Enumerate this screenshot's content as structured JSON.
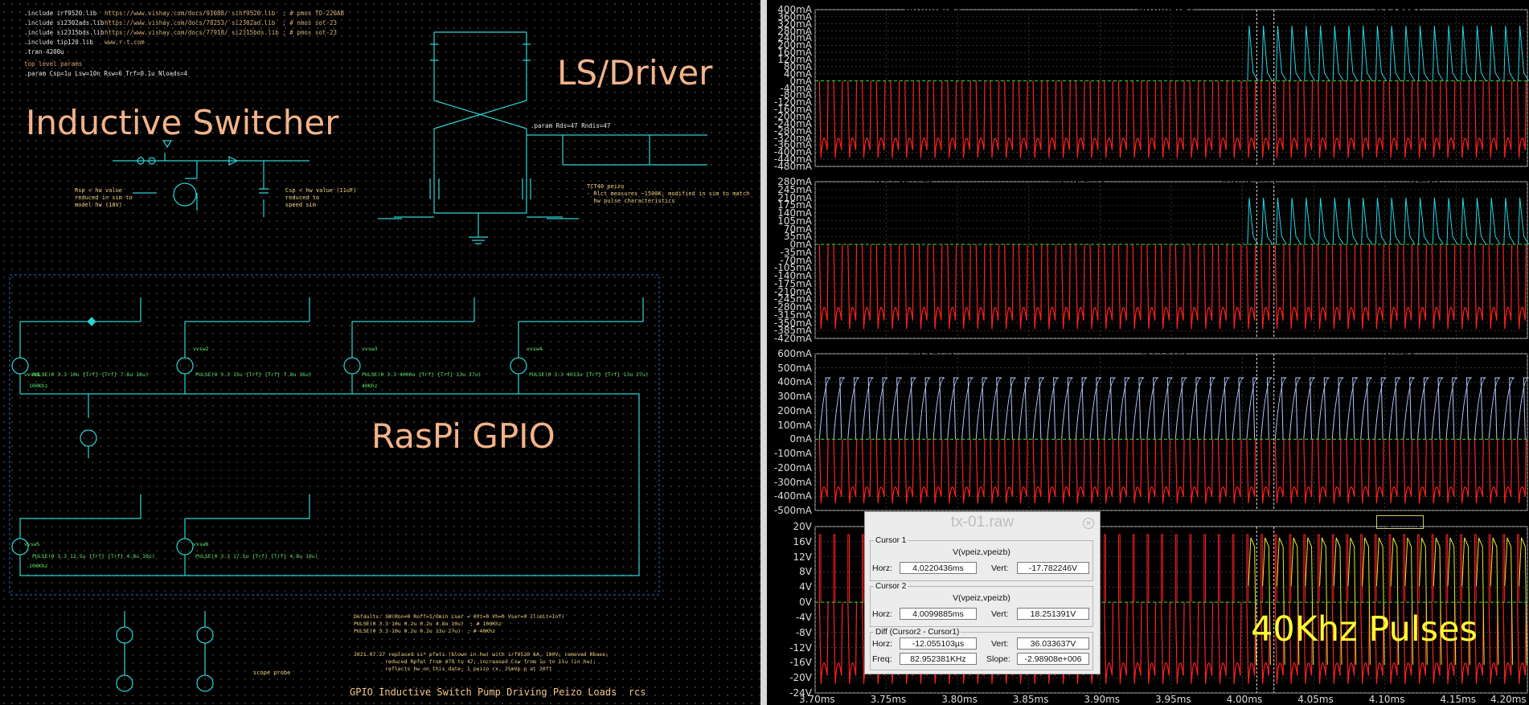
{
  "schematic": {
    "directives": [
      ".include irf9520.lib",
      ".include si2302ads.lib",
      ".include si2315bds.lib",
      ".include tip120.lib"
    ],
    "urls": [
      "https://www.vishay.com/docs/91088/ sihf9520.lib  ; # pmos TO-220AB",
      "https://www.vishay.com/docs/78253/ si2302ad.lib  ; # nmos sot-23",
      "https://www.vishay.com/docs/77918/ si2315bds.lib ; # pmos sot-23",
      "www.r-t.com"
    ],
    "tran": ".tran 4200u",
    "params_label": "top level params",
    "params": ".param Csp=1u Lsw=10n Rsw=6 Trf=0.1u Nloads=4",
    "title_inductive": "Inductive Switcher",
    "title_ls": "LS/Driver",
    "title_raspi": "RasPi GPIO",
    "note_rsp": "Rsp < hw value\nreduced in sim to\nmodel hw (18V)",
    "note_csp": "Csp < hw value (11uF)\nreduced to\nspeed sim",
    "param_rds": ".param Rds=47 Rndis=47",
    "note_tct": "TCT40 peizo\n- Rlct measures ~1500K; modified in sim to match\n  hw pulse characteristics",
    "sources": [
      {
        "name": "vvsw1",
        "pulse": "PULSE(0 3.3 10u {Trf} {Trf} 7.8u 16u)",
        "freq": "100Khz"
      },
      {
        "name": "vvsw2",
        "pulse": "PULSE(0 3.3 15u {Trf} {Trf} 7.8u 16u)",
        "freq": ""
      },
      {
        "name": "vvsw3",
        "pulse": "PULSE(0 3.3 4000u {Trf} {Trf} 13u 27u)",
        "freq": "40Khz"
      },
      {
        "name": "vvsw4",
        "pulse": "PULSE(0 3.3 4013u {Trf} {Trf} 13u 27u)",
        "freq": ""
      },
      {
        "name": "vvsw5",
        "pulse": "PULSE(0 3.3 12.5u {Trf} {Trf} 4.8u 10u)",
        "freq": "100Khz"
      },
      {
        "name": "vvsw6",
        "pulse": "PULSE(0 3.3 17.5u {Trf} {Trf} 4.8u 10u)",
        "freq": ""
      }
    ],
    "defaults": "Defaults: SW(Ron=0 Roff=1/Gmin Lser = 0Vt=0 Vh=0 Vser=0 Ilimit=Inf)\nPULSE(0 3.3 10u 0.2u 0.2u 4.8u 10u)  ; # 100Khz\nPULSE(0 3.3 10u 0.2u 0.2u 13u 27u)  ; # 40Khz",
    "changelog": "2021.07.27 replaced si* pfets (blown in hw) with irf9520 6A, 100V; removed Rbase;\n          reduced Rpfet from 470 to 47; increased Csw from 1u to 11u (in hw);\n          reflects hw on this date; 1 peizo rx, 25mVp-p at 20ft",
    "footer": "GPIO Inductive Switch Pump Driving Peizo Loads  rcs",
    "scope_probe": "scope probe"
  },
  "waveform": {
    "panes": [
      {
        "traces": [
          {
            "name": "Ix(mn1:D)",
            "color": "#c8c8c8"
          },
          {
            "name": "Ix(mn2:D)",
            "color": "#22d8e8"
          },
          {
            "name": "I(Vvcc9)",
            "color": "#ff2020"
          }
        ],
        "yticks": [
          "400mA",
          "360mA",
          "320mA",
          "280mA",
          "240mA",
          "200mA",
          "160mA",
          "120mA",
          "80mA",
          "40mA",
          "0mA",
          "-40mA",
          "-80mA",
          "-120mA",
          "-160mA",
          "-200mA",
          "-240mA",
          "-280mA",
          "-320mA",
          "-360mA",
          "-400mA",
          "-440mA",
          "-480mA"
        ]
      },
      {
        "traces": [
          {
            "name": "I(Vvgpio1)",
            "color": "#e8e830"
          },
          {
            "name": "Ix(mp1:S)",
            "color": "#30e030"
          },
          {
            "name": "Ix(mp2:S)",
            "color": "#22d8e8"
          },
          {
            "name": "I(Lsp)",
            "color": "#ff2020"
          }
        ],
        "yticks": [
          "280mA",
          "245mA",
          "210mA",
          "175mA",
          "140mA",
          "105mA",
          "70mA",
          "35mA",
          "0mA",
          "-35mA",
          "-70mA",
          "-105mA",
          "-140mA",
          "-175mA",
          "-210mA",
          "-245mA",
          "-280mA",
          "-315mA",
          "-350mA",
          "-385mA",
          "-420mA"
        ]
      },
      {
        "traces": [
          {
            "name": "Ix(Q1:C)",
            "color": "#b8c8ff"
          },
          {
            "name": "I(Vvcc5)",
            "color": "#ff2020"
          },
          {
            "name": "I(Rsp)",
            "color": "#30e030"
          }
        ],
        "yticks": [
          "600mA",
          "500mA",
          "400mA",
          "300mA",
          "200mA",
          "100mA",
          "0mA",
          "-100mA",
          "-200mA",
          "-300mA",
          "-400mA",
          "-500mA"
        ]
      },
      {
        "traces": [
          {
            "name": "V(vsw)",
            "color": "#ff2020"
          },
          {
            "name": "V(vout)",
            "color": "#e8e830"
          }
        ],
        "yticks": [
          "20V",
          "16V",
          "12V",
          "8V",
          "4V",
          "0V",
          "-4V",
          "-8V",
          "-12V",
          "-16V",
          "-20V",
          "-24V"
        ]
      }
    ],
    "xticks": [
      "3.70ms",
      "3.75ms",
      "3.80ms",
      "3.85ms",
      "3.90ms",
      "3.95ms",
      "4.00ms",
      "4.05ms",
      "4.10ms",
      "4.15ms",
      "4.20ms"
    ],
    "x_range": [
      3.7,
      4.2
    ],
    "cursor1_ms": 4.0220436,
    "cursor2_ms": 4.0099885,
    "annotation": "40Khz Pulses"
  },
  "cursor_dialog": {
    "title": "tx-01.raw",
    "cursor1": {
      "label": "Cursor 1",
      "expr": "V(vpeiz,vpeizb)",
      "horz_label": "Horz:",
      "horz": "4.0220436ms",
      "vert_label": "Vert:",
      "vert": "-17.782246V"
    },
    "cursor2": {
      "label": "Cursor 2",
      "expr": "V(vpeiz,vpeizb)",
      "horz_label": "Horz:",
      "horz": "4.0099885ms",
      "vert_label": "Vert:",
      "vert": "18.251391V"
    },
    "diff": {
      "label": "Diff (Cursor2 - Cursor1)",
      "horz_label": "Horz:",
      "horz": "-12.055103µs",
      "vert_label": "Vert:",
      "vert": "36.033637V",
      "freq_label": "Freq:",
      "freq": "82.952381KHz",
      "slope_label": "Slope:",
      "slope": "-2.98908e+006"
    }
  }
}
